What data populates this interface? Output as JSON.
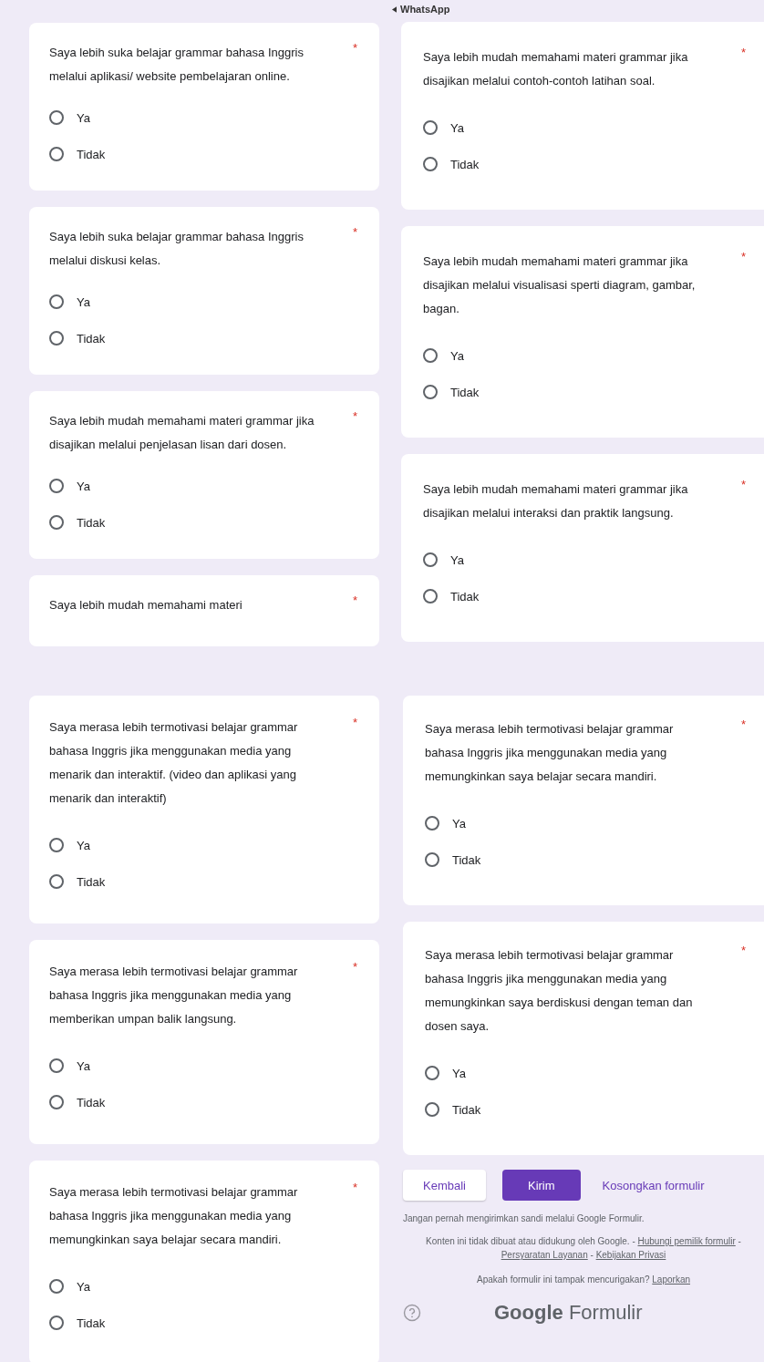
{
  "panels": [
    {
      "questions": [
        {
          "text": "Saya lebih suka belajar grammar bahasa Inggris melalui aplikasi/ website pembelajaran online.",
          "mark": "*",
          "options": [
            {
              "label": "Ya",
              "selected": false
            },
            {
              "label": "Tidak",
              "selected": false
            }
          ]
        },
        {
          "text": "Saya lebih suka belajar grammar bahasa Inggris melalui diskusi kelas.",
          "mark": "*",
          "options": [
            {
              "label": "Ya",
              "selected": false
            },
            {
              "label": "Tidak",
              "selected": false
            }
          ]
        },
        {
          "text": "Saya lebih mudah memahami materi grammar jika disajikan melalui penjelasan lisan dari dosen.",
          "mark": "*",
          "options": [
            {
              "label": "Ya",
              "selected": false
            },
            {
              "label": "Tidak",
              "selected": false
            }
          ]
        },
        {
          "text": "Saya lebih mudah memahami materi",
          "mark": "*"
        }
      ]
    },
    {
      "questions": [
        {
          "text": "Saya merasa lebih termotivasi belajar grammar bahasa Inggris jika menggunakan media yang menarik dan interaktif. (video dan aplikasi yang menarik dan interaktif)",
          "mark": "*",
          "options": [
            {
              "label": "Ya",
              "selected": false
            },
            {
              "label": "Tidak",
              "selected": false
            }
          ]
        },
        {
          "text": "Saya merasa lebih termotivasi belajar grammar bahasa Inggris jika menggunakan media yang memberikan umpan balik langsung.",
          "mark": "*",
          "options": [
            {
              "label": "Ya",
              "selected": false
            },
            {
              "label": "Tidak",
              "selected": false
            }
          ]
        },
        {
          "text": "Saya merasa lebih termotivasi belajar grammar bahasa Inggris jika menggunakan media yang memungkinkan saya belajar secara mandiri.",
          "mark": "*",
          "options": [
            {
              "label": "Ya",
              "selected": false
            },
            {
              "label": "Tidak",
              "selected": false
            }
          ]
        }
      ]
    },
    {
      "back_link": "WhatsApp",
      "questions": [
        {
          "text": "Saya lebih mudah memahami materi grammar jika disajikan melalui contoh-contoh latihan soal.",
          "mark": "*",
          "options": [
            {
              "label": "Ya",
              "selected": false
            },
            {
              "label": "Tidak",
              "selected": false
            }
          ]
        },
        {
          "text": "Saya lebih mudah memahami materi grammar jika disajikan melalui visualisasi sperti diagram, gambar, bagan.",
          "mark": "*",
          "options": [
            {
              "label": "Ya",
              "selected": false
            },
            {
              "label": "Tidak",
              "selected": false
            }
          ]
        },
        {
          "text": "Saya lebih mudah memahami materi grammar jika disajikan melalui interaksi dan praktik langsung.",
          "mark": "*",
          "options": [
            {
              "label": "Ya",
              "selected": false
            },
            {
              "label": "Tidak",
              "selected": false
            }
          ]
        }
      ]
    },
    {
      "questions": [
        {
          "text": "Saya merasa lebih termotivasi belajar grammar bahasa Inggris jika menggunakan media yang memungkinkan saya belajar secara mandiri.",
          "mark": "*",
          "options": [
            {
              "label": "Ya",
              "selected": false
            },
            {
              "label": "Tidak",
              "selected": false
            }
          ]
        },
        {
          "text": "Saya merasa lebih termotivasi belajar grammar bahasa Inggris jika menggunakan media yang memungkinkan saya berdiskusi dengan teman dan dosen saya.",
          "mark": "*",
          "options": [
            {
              "label": "Ya",
              "selected": false
            },
            {
              "label": "Tidak",
              "selected": false
            }
          ]
        }
      ],
      "footer": {
        "back_button": "Kembali",
        "submit_button": "Kirim",
        "clear_link": "Kosongkan formulir",
        "warning": "Jangan pernah mengirimkan sandi melalui Google Formulir.",
        "notice": [
          {
            "kind": "text",
            "text": "Konten ini tidak dibuat atau didukung oleh Google. - "
          },
          {
            "kind": "link",
            "text": "Hubungi pemilik formulir"
          },
          {
            "kind": "text",
            "text": " - "
          },
          {
            "kind": "link",
            "text": "Persyaratan Layanan"
          },
          {
            "kind": "text",
            "text": " - "
          },
          {
            "kind": "link",
            "text": "Kebijakan Privasi"
          }
        ],
        "report": [
          {
            "kind": "text",
            "text": "Apakah formulir ini tampak mencurigakan? "
          },
          {
            "kind": "link",
            "text": "Laporkan"
          }
        ],
        "logo": {
          "brand": "Google",
          "product": "Formulir"
        }
      }
    }
  ]
}
